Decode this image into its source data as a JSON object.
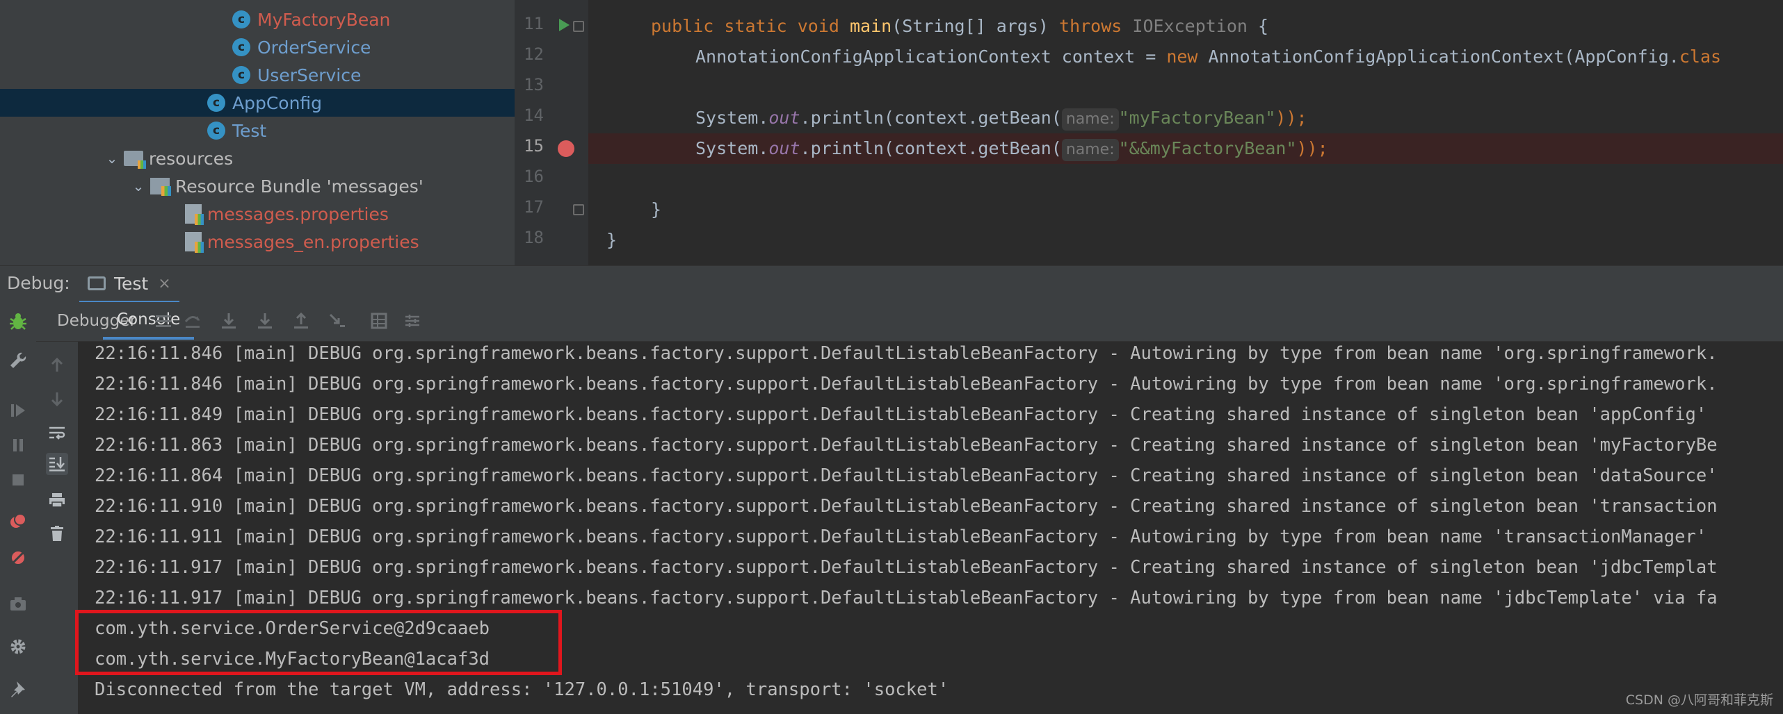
{
  "project_tree": {
    "items": [
      {
        "label": "MyFactoryBean",
        "kind": "class",
        "status": "modified"
      },
      {
        "label": "OrderService",
        "kind": "class",
        "status": "normal"
      },
      {
        "label": "UserService",
        "kind": "class",
        "status": "normal"
      },
      {
        "label": "AppConfig",
        "kind": "class",
        "status": "selected"
      },
      {
        "label": "Test",
        "kind": "runnable-class",
        "status": "normal"
      },
      {
        "label": "resources",
        "kind": "folder",
        "status": "expanded"
      },
      {
        "label": "Resource Bundle 'messages'",
        "kind": "bundle",
        "status": "expanded"
      },
      {
        "label": "messages.properties",
        "kind": "properties",
        "status": "modified"
      },
      {
        "label": "messages_en.properties",
        "kind": "properties",
        "status": "modified"
      }
    ]
  },
  "editor": {
    "line_numbers": [
      "11",
      "12",
      "13",
      "14",
      "15",
      "16",
      "17",
      "18"
    ],
    "current_line": "15",
    "line11": {
      "kw1": "public static void ",
      "method": "main",
      "args": "(String[] args) ",
      "kw2": "throws ",
      "exc": "IOException",
      "brace": " {"
    },
    "line12": {
      "text1": "AnnotationConfigApplicationContext context = ",
      "kw": "new ",
      "text2": "AnnotationConfigApplicationContext(AppConfig.",
      "kw2": "clas"
    },
    "line14": {
      "pre": "System.",
      "field": "out",
      "mid": ".println(context.getBean(",
      "hint": "name:",
      "str": "\"myFactoryBean\"",
      "end": "));"
    },
    "line15": {
      "pre": "System.",
      "field": "out",
      "mid": ".println(context.getBean(",
      "hint": "name:",
      "str": "\"&&myFactoryBean\"",
      "end": "));"
    },
    "line17": "}",
    "line18": "}"
  },
  "debug": {
    "title": "Debug:",
    "tab_label": "Test",
    "close_glyph": "×",
    "subtabs": [
      "Debugger",
      "Console"
    ],
    "active_subtab": "Console"
  },
  "console": {
    "lines": [
      "22:16:11.846 [main] DEBUG org.springframework.beans.factory.support.DefaultListableBeanFactory - Autowiring by type from bean name 'org.springframework.",
      "22:16:11.846 [main] DEBUG org.springframework.beans.factory.support.DefaultListableBeanFactory - Autowiring by type from bean name 'org.springframework.",
      "22:16:11.849 [main] DEBUG org.springframework.beans.factory.support.DefaultListableBeanFactory - Creating shared instance of singleton bean 'appConfig'",
      "22:16:11.863 [main] DEBUG org.springframework.beans.factory.support.DefaultListableBeanFactory - Creating shared instance of singleton bean 'myFactoryBe",
      "22:16:11.864 [main] DEBUG org.springframework.beans.factory.support.DefaultListableBeanFactory - Creating shared instance of singleton bean 'dataSource'",
      "22:16:11.910 [main] DEBUG org.springframework.beans.factory.support.DefaultListableBeanFactory - Creating shared instance of singleton bean 'transaction",
      "22:16:11.911 [main] DEBUG org.springframework.beans.factory.support.DefaultListableBeanFactory - Autowiring by type from bean name 'transactionManager'",
      "22:16:11.917 [main] DEBUG org.springframework.beans.factory.support.DefaultListableBeanFactory - Creating shared instance of singleton bean 'jdbcTemplat",
      "22:16:11.917 [main] DEBUG org.springframework.beans.factory.support.DefaultListableBeanFactory - Autowiring by type from bean name 'jdbcTemplate' via fa",
      "com.yth.service.OrderService@2d9caaeb",
      "com.yth.service.MyFactoryBean@1acaf3d",
      "Disconnected from the target VM, address: '127.0.0.1:51049', transport: 'socket'"
    ]
  },
  "watermark": "CSDN @八阿哥和菲克斯",
  "colors": {
    "accent": "#4a88c7",
    "highlight_box": "#e0161d",
    "breakpoint": "#db5c5c",
    "run_arrow": "#499c54"
  },
  "icons": {
    "left_toolbar": [
      "bug-icon",
      "wrench-icon",
      "resume-icon",
      "pause-icon",
      "stop-icon",
      "view-breakpoints-icon",
      "mute-breakpoints-icon",
      "camera-icon",
      "settings-icon",
      "pin-icon"
    ],
    "console_toolbar": [
      "arrow-up-icon",
      "arrow-down-icon",
      "soft-wrap-icon",
      "scroll-to-end-icon",
      "print-icon",
      "trash-icon"
    ],
    "subtab_toolbar": [
      "menu-icon",
      "step-over-icon",
      "step-into-icon",
      "force-step-into-icon",
      "step-out-icon",
      "run-to-cursor-icon",
      "evaluate-icon",
      "trace-icon"
    ]
  }
}
